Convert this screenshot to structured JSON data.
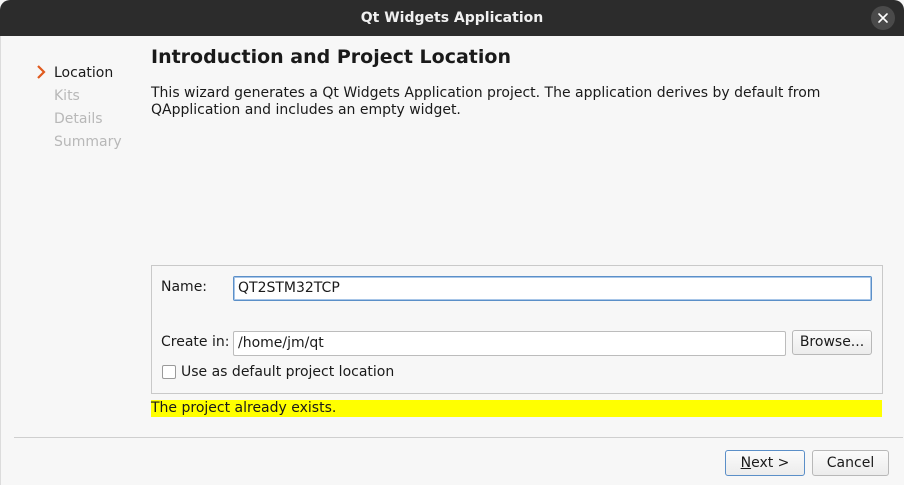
{
  "window": {
    "title": "Qt Widgets Application"
  },
  "steps": [
    {
      "label": "Location",
      "active": true
    },
    {
      "label": "Kits",
      "active": false
    },
    {
      "label": "Details",
      "active": false
    },
    {
      "label": "Summary",
      "active": false
    }
  ],
  "page": {
    "title": "Introduction and Project Location",
    "description_line1": "This wizard generates a Qt Widgets Application project. The application derives by default from",
    "description_line2": "QApplication and includes an empty widget."
  },
  "form": {
    "name_label": "Name:",
    "name_value": "QT2STM32TCP",
    "create_in_label": "Create in:",
    "create_in_value": "/home/jm/qt",
    "browse_label": "Browse...",
    "default_location_label": "Use as default project location",
    "default_location_checked": false
  },
  "warning": {
    "text": "The project already exists."
  },
  "footer": {
    "next_label": "Next >",
    "cancel_label": "Cancel"
  },
  "icons": {
    "close": "close-icon",
    "step_arrow": "chevron-right-icon"
  },
  "colors": {
    "titlebar": "#2c2c2c",
    "warning_bg": "#ffff00",
    "step_arrow": "#e05a1e",
    "focus_border": "#5b8fc8"
  }
}
